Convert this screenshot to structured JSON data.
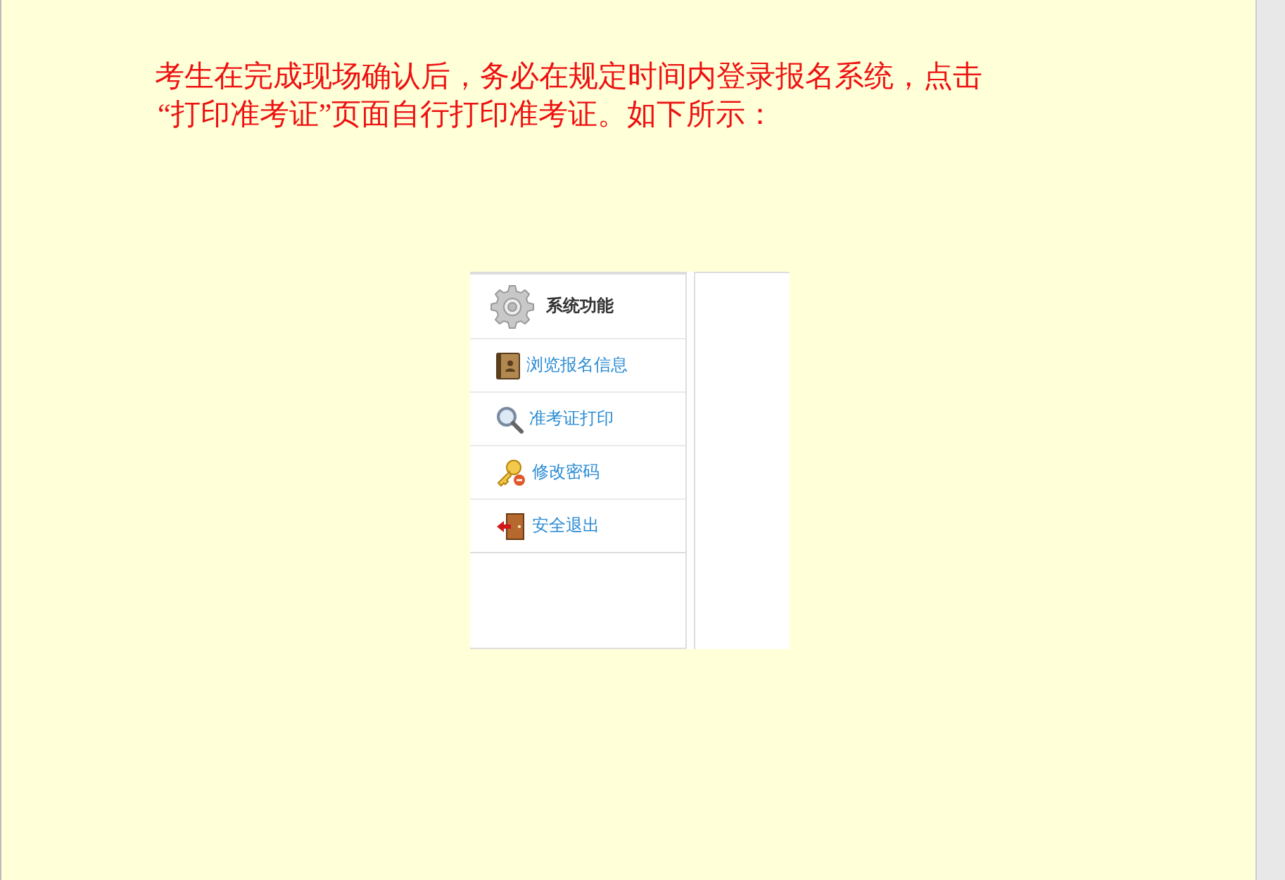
{
  "notice": {
    "lines": [
      "考生在完成现场确认后，务必在规定时间内登录报名系统，点击",
      "“打印准考证”页面自行打印准考证。如下所示："
    ]
  },
  "screenshot": {
    "menu": {
      "title": "系统功能",
      "items": [
        {
          "label": "浏览报名信息",
          "kind": "book"
        },
        {
          "label": "准考证打印",
          "kind": "search"
        },
        {
          "label": "修改密码",
          "kind": "key"
        },
        {
          "label": "安全退出",
          "kind": "exit"
        }
      ]
    }
  }
}
